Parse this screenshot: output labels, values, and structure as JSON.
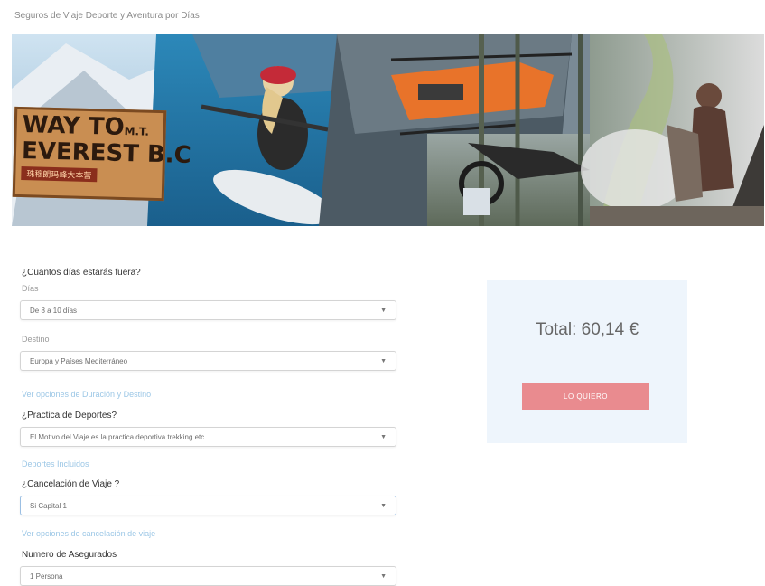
{
  "page": {
    "title": "Seguros de Viaje Deporte y Aventura por Días"
  },
  "banner": {
    "sign_line1": "WAY TO",
    "sign_line1_small": "M.T.",
    "sign_line2": "EVEREST B.C",
    "sign_line3": "珠穆朗玛峰大本营"
  },
  "form": {
    "days": {
      "question": "¿Cuantos días estarás fuera?",
      "label": "Días",
      "value": "De 8 a 10 días"
    },
    "destination": {
      "label": "Destino",
      "value": "Europa y Países Mediterráneo"
    },
    "link_options": "Ver opciones de Duración y Destino",
    "sports": {
      "question": "¿Practica de Deportes?",
      "value": "El Motivo del Viaje es la practica deportiva trekking etc."
    },
    "link_sports": "Deportes Incluidos",
    "cancel": {
      "question": "¿Cancelación de Viaje ?",
      "value": "Si Capital 1"
    },
    "link_cancel": "Ver opciones de cancelación de viaje",
    "insured": {
      "question": "Numero de Asegurados",
      "value": "1 Persona"
    }
  },
  "summary": {
    "total_label": "Total:",
    "total_value": "60,14 €",
    "button_label": "LO QUIERO"
  },
  "colors": {
    "accent_button": "#e98b8f",
    "panel_bg": "#eef5fc",
    "link": "#9cc7e6"
  }
}
